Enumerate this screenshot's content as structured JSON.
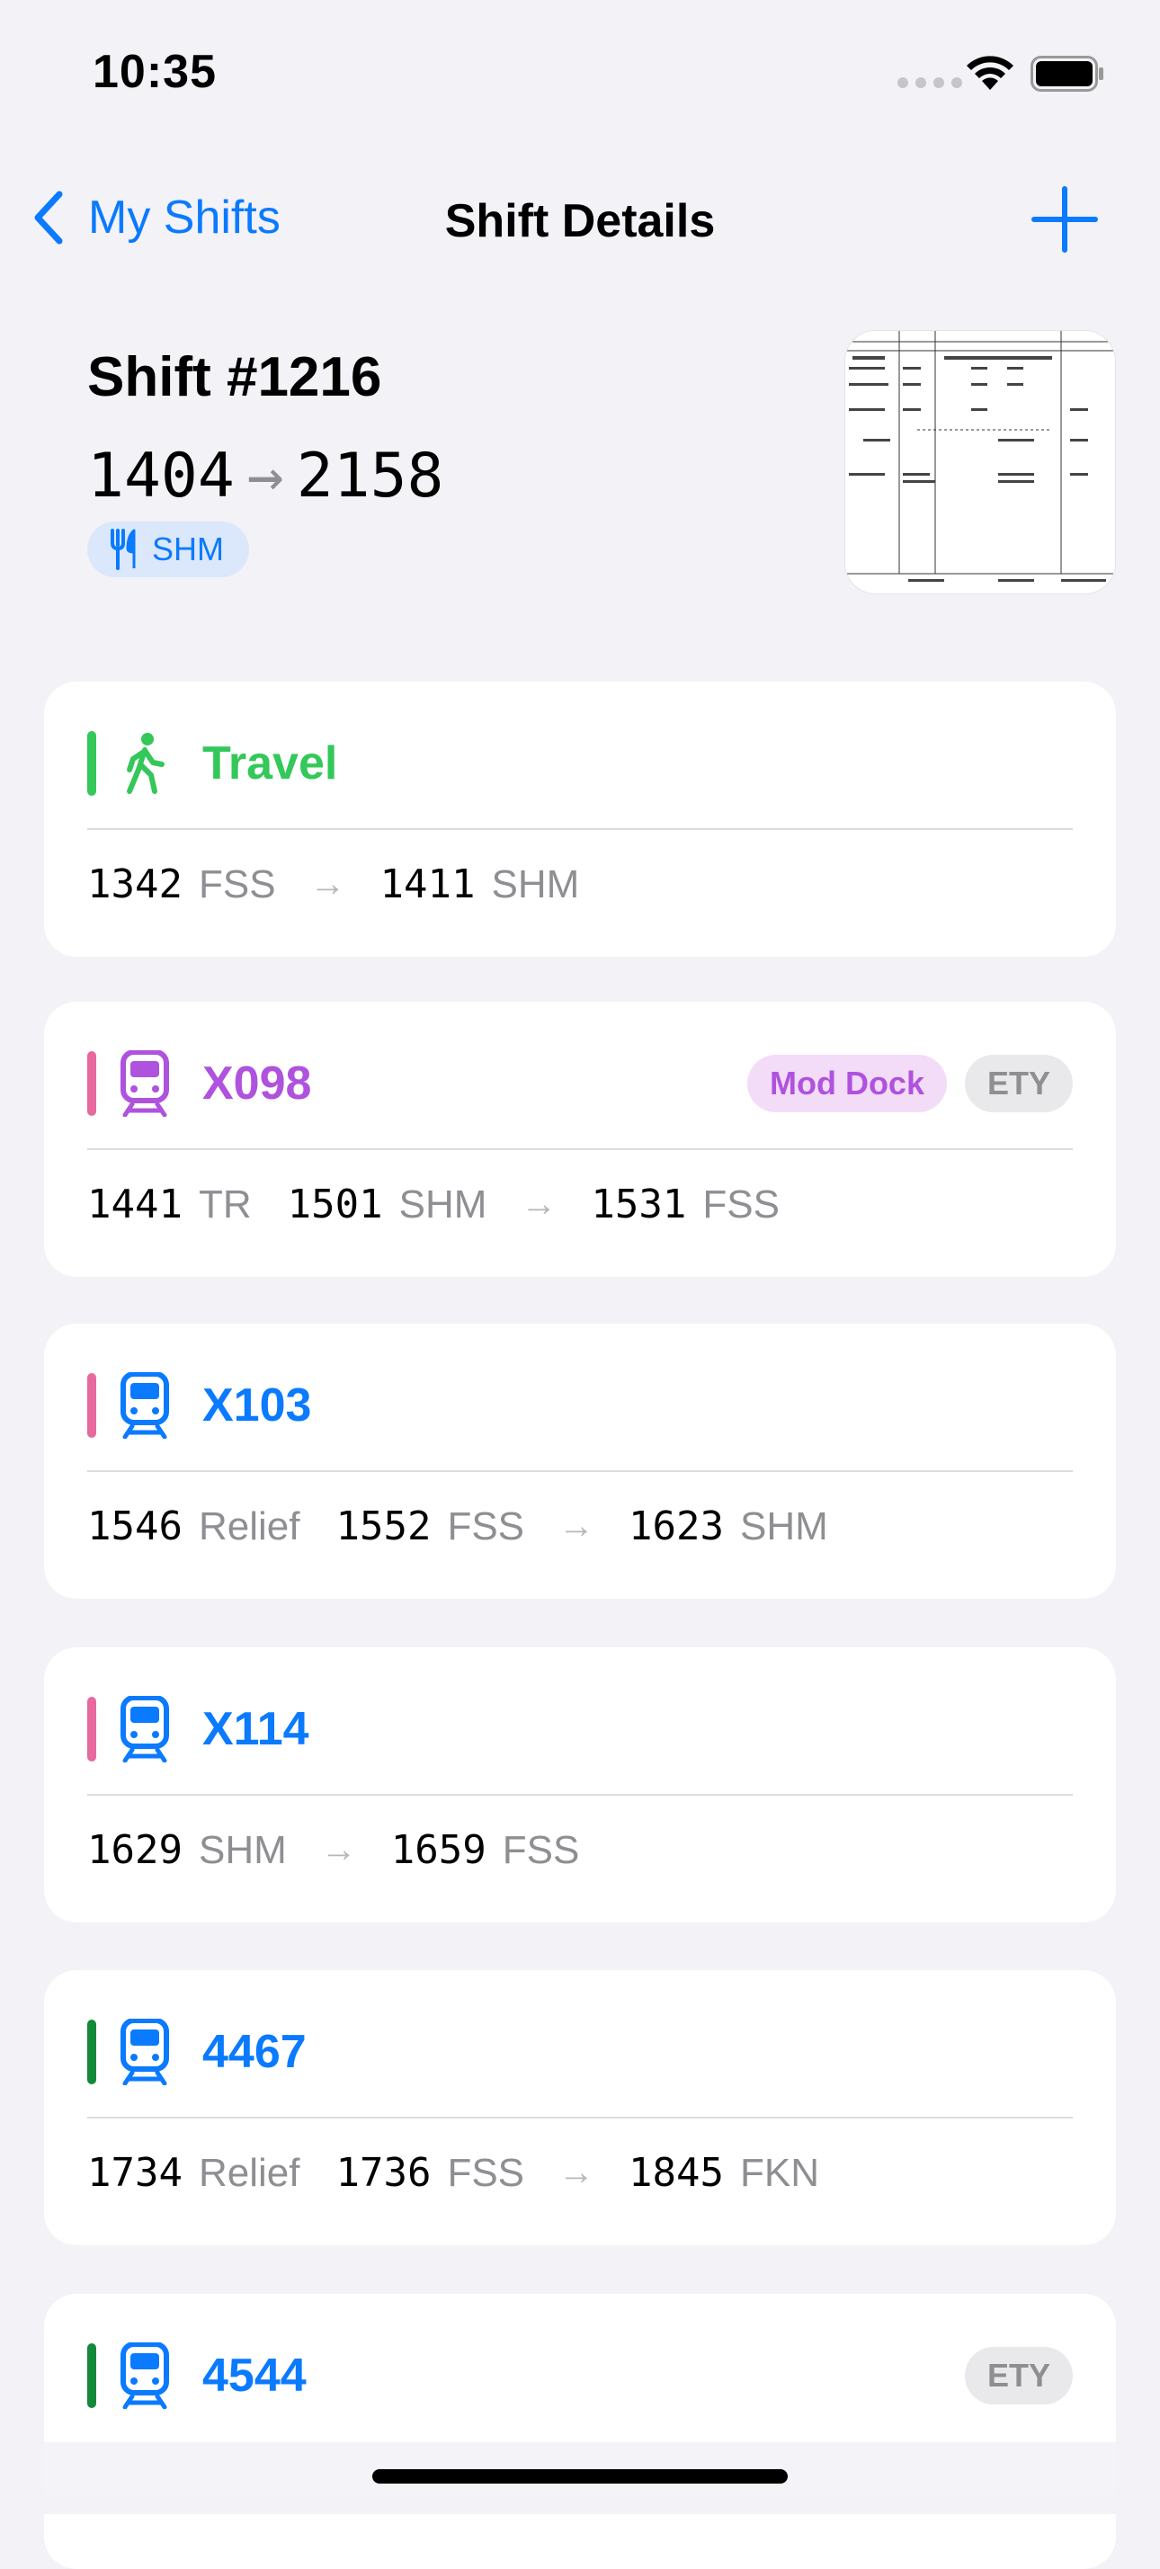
{
  "status": {
    "time": "10:35"
  },
  "nav": {
    "back_label": "My Shifts",
    "title": "Shift Details"
  },
  "shift": {
    "title": "Shift #1216",
    "start": "1404",
    "end": "2158",
    "arrow": "→",
    "meal_location": "SHM"
  },
  "colors": {
    "accent": "#0a7aff",
    "green": "#34c759",
    "purple": "#af52de",
    "pink": "#e8699e",
    "dark_green": "#13893a"
  },
  "cards": [
    {
      "title": "Travel",
      "icon": "walking-person-icon",
      "times": [
        "1342",
        "FSS",
        "1411",
        "SHM"
      ]
    },
    {
      "title": "X098",
      "icon": "train-icon",
      "tags": [
        "Mod Dock",
        "ETY"
      ],
      "times": [
        "1441",
        "TR",
        "1501",
        "SHM",
        "1531",
        "FSS"
      ]
    },
    {
      "title": "X103",
      "icon": "train-icon",
      "times": [
        "1546",
        "Relief",
        "1552",
        "FSS",
        "1623",
        "SHM"
      ]
    },
    {
      "title": "X114",
      "icon": "train-icon",
      "times": [
        "1629",
        "SHM",
        "1659",
        "FSS"
      ]
    },
    {
      "title": "4467",
      "icon": "train-icon",
      "times": [
        "1734",
        "Relief",
        "1736",
        "FSS",
        "1845",
        "FKN"
      ]
    },
    {
      "title": "4544",
      "icon": "train-icon",
      "tags": [
        "ETY"
      ]
    }
  ],
  "arrow": "→"
}
